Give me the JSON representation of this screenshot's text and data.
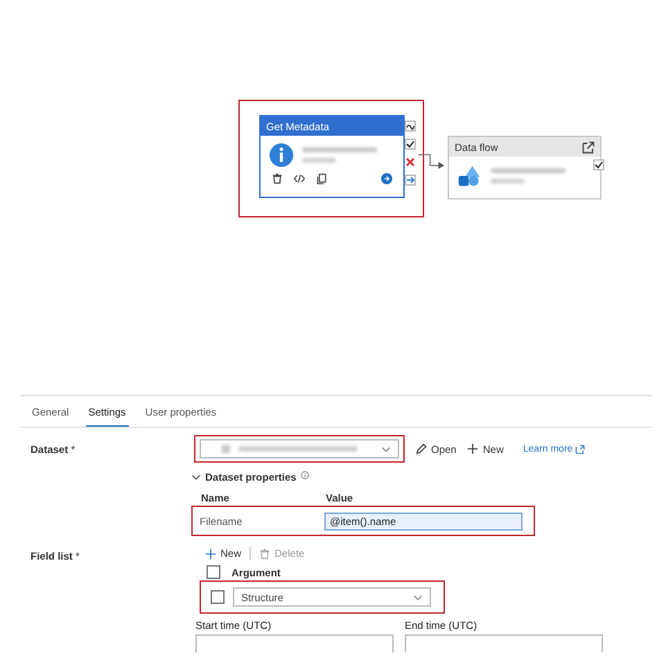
{
  "canvas": {
    "activities": [
      {
        "kind": "get_metadata",
        "title": "Get Metadata",
        "selected": true,
        "highlighted": true
      },
      {
        "kind": "data_flow",
        "title": "Data flow",
        "selected": false,
        "highlighted": false
      }
    ]
  },
  "tabs": [
    {
      "label": "General",
      "selected": false
    },
    {
      "label": "Settings",
      "selected": true
    },
    {
      "label": "User properties",
      "selected": false
    }
  ],
  "dataset": {
    "label": "Dataset",
    "required": "*",
    "highlighted": true,
    "actions": [
      {
        "kind": "open",
        "label": "Open"
      },
      {
        "kind": "new",
        "label": "New"
      },
      {
        "kind": "learn",
        "label": "Learn more"
      }
    ]
  },
  "dataset_properties": {
    "title": "Dataset properties",
    "expanded": true,
    "columns": [
      "Name",
      "Value"
    ],
    "rows": [
      {
        "name": "Filename",
        "value": "@item().name",
        "highlighted": true
      }
    ]
  },
  "field_list": {
    "label": "Field list",
    "required": "*",
    "toolbar": [
      {
        "kind": "new",
        "label": "New",
        "disabled": false
      },
      {
        "kind": "delete",
        "label": "Delete",
        "disabled": true
      }
    ],
    "header": "Argument",
    "header_checked": false,
    "rows": [
      {
        "value": "Structure",
        "checked": false,
        "highlighted": true
      }
    ]
  },
  "times": [
    {
      "label": "Start time (UTC)"
    },
    {
      "label": "End time (UTC)"
    }
  ]
}
